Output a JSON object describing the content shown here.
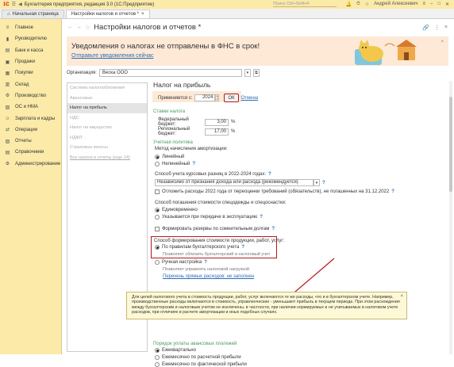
{
  "app": {
    "logo": "1С",
    "title": "Бухгалтерия предприятия, редакция 3.0  (1С:Предприятие)",
    "search_placeholder": "Поиск Ctrl+Shift+F",
    "user": "Андрей Алексеевич"
  },
  "tabs": [
    {
      "label": "Начальная страница"
    },
    {
      "label": "Настройки налогов и отчетов *"
    }
  ],
  "sidebar": {
    "items": [
      {
        "label": "Главное",
        "icon": "menu-icon"
      },
      {
        "label": "Руководителю",
        "icon": "chart-icon"
      },
      {
        "label": "Банк и касса",
        "icon": "bank-icon"
      },
      {
        "label": "Продажи",
        "icon": "cart-icon"
      },
      {
        "label": "Покупки",
        "icon": "basket-icon"
      },
      {
        "label": "Склад",
        "icon": "warehouse-icon"
      },
      {
        "label": "Производство",
        "icon": "factory-icon"
      },
      {
        "label": "ОС и НМА",
        "icon": "building-icon"
      },
      {
        "label": "Зарплата и кадры",
        "icon": "people-icon"
      },
      {
        "label": "Операции",
        "icon": "operations-icon"
      },
      {
        "label": "Отчеты",
        "icon": "report-icon"
      },
      {
        "label": "Справочники",
        "icon": "book-icon"
      },
      {
        "label": "Администрирование",
        "icon": "gear-icon"
      }
    ]
  },
  "page": {
    "title": "Настройки налогов и отчетов *"
  },
  "banner": {
    "headline": "Уведомления о налогах не отправлены в ФНС в срок!",
    "link": "Отправьте уведомления сейчас"
  },
  "org": {
    "label": "Организация:",
    "value": "Веска ООО"
  },
  "leftnav": {
    "items": [
      {
        "label": "Система налогообложения",
        "active": false
      },
      {
        "label": "Авансовые",
        "active": false
      },
      {
        "label": "Налог на прибыль",
        "active": true
      },
      {
        "label": "НДС",
        "active": false
      },
      {
        "label": "Налог на имущество",
        "active": false
      },
      {
        "label": "НДФЛ",
        "active": false
      },
      {
        "label": "Страховые взносы",
        "active": false
      },
      {
        "label": "Все налоги и отчеты (еще 14)",
        "active": false
      }
    ]
  },
  "content": {
    "title": "Налог на прибыль",
    "applies_label": "Применяется с:",
    "applies_year": "2024",
    "ok_button": "ОК",
    "cancel_link": "Отмена",
    "rates_header": "Ставки налога",
    "fed_label": "Федеральный бюджет:",
    "fed_value": "3,00",
    "reg_label": "Региональный бюджет:",
    "reg_value": "17,00",
    "pct": "%",
    "policy_header": "Учетная политика",
    "amort_label": "Метод начисления амортизации:",
    "amort_linear": "Линейный",
    "amort_nonlinear": "Нелинейный",
    "exchange_label": "Способ учета курсовых разниц в 2022-2024 годах:",
    "exchange_value": "Независимо от признания дохода или расхода (рекомендуется)",
    "defer_label": "Отложить расходы 2022 года от переоценки требований (обязательств), не погашенных на 31.12.2022",
    "spec_label": "Способ погашения стоимости спецодежды и спецоснастки:",
    "spec_once": "Единовременно",
    "spec_use": "Указывается при передаче в эксплуатацию",
    "reserve_label": "Формировать резервы по сомнительным долгам",
    "cost_label": "Способ формирования стоимости продукции, работ, услуг:",
    "cost_rules": "По правилам бухгалтерского учета",
    "cost_rules_hint": "Позволяет сблизить бухгалтерский и налоговый учет",
    "cost_manual": "Ручная настройка",
    "cost_manual_hint": "Позволяет управлять налоговой нагрузкой",
    "direct_costs_link": "Перечень прямых расходов: не заполнен",
    "tooltip": "Для целей налогового учета в стоимость продукции, работ, услуг включаются те же расходы, что и в бухгалтерском учете. Например, производственные расходы включаются в стоимость, управленческие - уменьшают прибыль в текущем периоде. При этом расхождения между бухгалтерским и налоговым учетом не исключены, в частности, при наличии нормируемых и не учитываемых в налоговом учете расходов, при отличиях в расчете амортизации и иных подобных случаях.",
    "advance_header": "Порядок уплаты авансовых платежей",
    "adv_quarterly": "Ежеквартально",
    "adv_monthly_calc": "Ежемесячно по расчетной прибыли",
    "adv_monthly_fact": "Ежемесячно по фактической прибыли"
  },
  "colors": {
    "sidebar_bg": "#fbeaa8",
    "banner_bg": "#fde9d6",
    "accent_link": "#2f6cb5",
    "section_green": "#4a9a5e",
    "highlight_red": "#b21b1b"
  }
}
